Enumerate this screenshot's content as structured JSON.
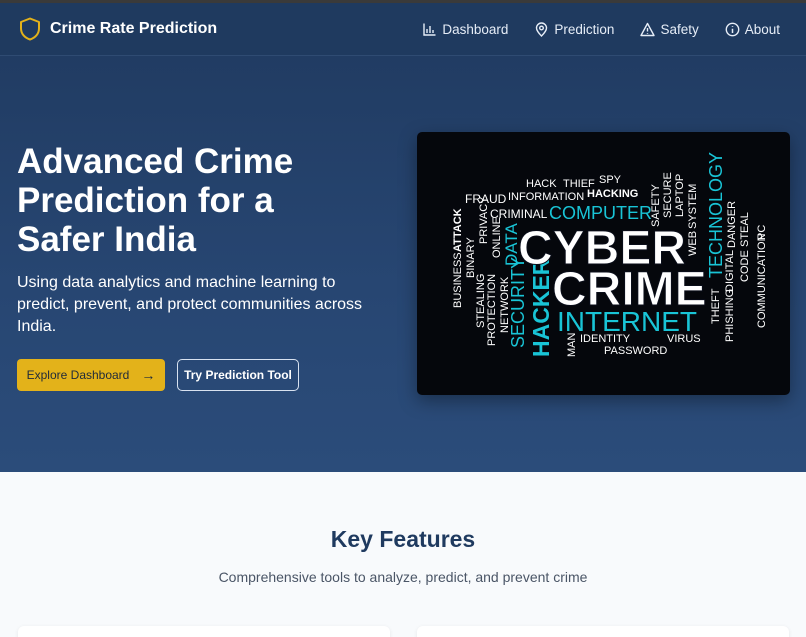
{
  "navbar": {
    "brand": "Crime Rate Prediction",
    "links": [
      {
        "label": "Dashboard",
        "icon": "bar-chart-icon"
      },
      {
        "label": "Prediction",
        "icon": "map-pin-icon"
      },
      {
        "label": "Safety",
        "icon": "warning-triangle-icon"
      },
      {
        "label": "About",
        "icon": "info-circle-icon"
      }
    ]
  },
  "hero": {
    "title": "Advanced Crime Prediction for a Safer India",
    "subtitle": "Using data analytics and machine learning to predict, prevent, and protect communities across India.",
    "primary_button": "Explore Dashboard",
    "secondary_button": "Try Prediction Tool",
    "image": {
      "words": [
        "HACK",
        "THIEF",
        "SPY",
        "HACKING",
        "FRAUD",
        "INFORMATION",
        "ATTACK",
        "PRIVACY",
        "CRIMINAL",
        "COMPUTER",
        "SAFETY",
        "SECURE",
        "LAPTOP",
        "TECHNOLOGY",
        "BUSINESS",
        "BINARY",
        "ONLINE",
        "DATA",
        "CYBER",
        "WEB",
        "SYSTEM",
        "DANGER",
        "STEAL",
        "PC",
        "STEALING",
        "NETWORK",
        "SECURITY",
        "HACKER",
        "CRIME",
        "CODE",
        "COMMUNICATION",
        "PROTECTION",
        "INTERNET",
        "THEFT",
        "DIGITAL",
        "PHISHING",
        "MAN",
        "IDENTITY",
        "VIRUS",
        "PASSWORD"
      ]
    }
  },
  "features": {
    "title": "Key Features",
    "subtitle": "Comprehensive tools to analyze, predict, and prevent crime"
  },
  "colors": {
    "navbar": "#1f3a5f",
    "hero": "#274672",
    "accent": "#e3b21a",
    "word_cyan": "#19c4d6",
    "word_white": "#ffffff"
  }
}
